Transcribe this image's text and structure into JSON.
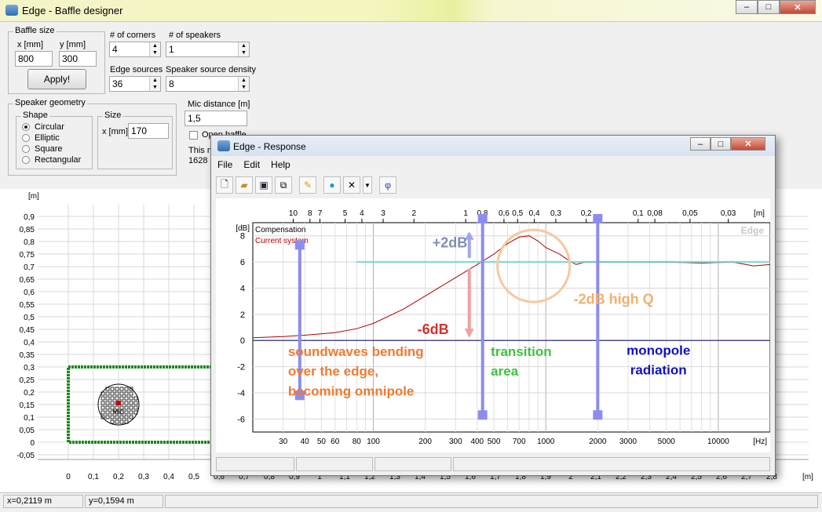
{
  "main_window": {
    "title": "Edge - Baffle designer",
    "caption_buttons": [
      "minimize",
      "maximize",
      "close"
    ]
  },
  "baffle_size": {
    "group_label": "Baffle size",
    "x_label": "x [mm]",
    "y_label": "y [mm]",
    "x_value": "800",
    "y_value": "300",
    "apply_label": "Apply!"
  },
  "corners": {
    "label": "# of corners",
    "value": "4"
  },
  "speakers": {
    "label": "# of speakers",
    "value": "1"
  },
  "edge_sources": {
    "label": "Edge sources",
    "value": "36"
  },
  "speaker_density": {
    "label": "Speaker source density",
    "value": "8"
  },
  "mic_distance": {
    "label": "Mic distance [m]",
    "value": "1,5"
  },
  "open_baffle": {
    "label": "Open baffle",
    "checked": false
  },
  "partial_info": {
    "line1": "This m",
    "line2": "1628"
  },
  "speaker_geometry": {
    "group_label": "Speaker geometry",
    "shape_label": "Shape",
    "shapes": [
      "Circular",
      "Elliptic",
      "Square",
      "Rectangular"
    ],
    "selected": "Circular",
    "size_label": "Size",
    "size_x_label": "x [mm]",
    "size_value": "170"
  },
  "baffle_plot": {
    "y_unit": "[m]",
    "x_unit": "[m]",
    "y_ticks": [
      "0,9",
      "0,85",
      "0,8",
      "0,75",
      "0,7",
      "0,65",
      "0,6",
      "0,55",
      "0,5",
      "0,45",
      "0,4",
      "0,35",
      "0,3",
      "0,25",
      "0,2",
      "0,15",
      "0,1",
      "0,05",
      "0",
      "-0,05"
    ],
    "x_ticks": [
      "0",
      "0,1",
      "0,2",
      "0,3",
      "0,4",
      "0,5",
      "0,6",
      "0,7",
      "0,8",
      "0,9",
      "1",
      "1,1",
      "1,2",
      "1,3",
      "1,4",
      "1,5",
      "1,6",
      "1,7",
      "1,8",
      "1,9",
      "2",
      "2,1",
      "2,2",
      "2,3",
      "2,4",
      "2,5",
      "2,6",
      "2,7",
      "2,8"
    ],
    "mic_label": "MIC"
  },
  "status_bar": {
    "x_readout": "x=0,2119 m",
    "y_readout": "y=0,1594 m"
  },
  "response_window": {
    "title": "Edge - Response",
    "menus": [
      "File",
      "Edit",
      "Help"
    ],
    "toolbar_icons": [
      "new-file-icon",
      "open-folder-icon",
      "save-icon",
      "copy-icon",
      "pencil-icon",
      "globe-icon",
      "delete-x-icon",
      "dropdown-arrow-icon",
      "phi-icon"
    ],
    "phi_glyph": "φ",
    "watermark": "Edge",
    "legend": [
      "Compensation",
      "Current system"
    ]
  },
  "chart_data": {
    "type": "line",
    "x_scale": "log",
    "xlabel": "[Hz]",
    "ylabel": "[dB]",
    "top_axis_label": "[m]",
    "xlim": [
      20,
      20000
    ],
    "ylim": [
      -7,
      9
    ],
    "x_ticks": [
      30,
      40,
      50,
      60,
      80,
      100,
      200,
      300,
      400,
      500,
      700,
      1000,
      2000,
      3000,
      5000,
      10000
    ],
    "y_ticks": [
      8,
      6,
      4,
      2,
      0,
      -2,
      -4,
      -6
    ],
    "top_ticks": [
      {
        "label": "10",
        "hz": 34.3
      },
      {
        "label": "8",
        "hz": 42.9
      },
      {
        "label": "7",
        "hz": 49
      },
      {
        "label": "5",
        "hz": 68.6
      },
      {
        "label": "4",
        "hz": 85.8
      },
      {
        "label": "3",
        "hz": 114
      },
      {
        "label": "2",
        "hz": 172
      },
      {
        "label": "1",
        "hz": 343
      },
      {
        "label": "0,8",
        "hz": 429
      },
      {
        "label": "0,6",
        "hz": 572
      },
      {
        "label": "0,5",
        "hz": 686
      },
      {
        "label": "0,4",
        "hz": 858
      },
      {
        "label": "0,3",
        "hz": 1143
      },
      {
        "label": "0,2",
        "hz": 1715
      },
      {
        "label": "0,1",
        "hz": 3430
      },
      {
        "label": "0,08",
        "hz": 4288
      },
      {
        "label": "0,05",
        "hz": 6860
      },
      {
        "label": "0,03",
        "hz": 11433
      }
    ],
    "series": [
      {
        "name": "Current system",
        "color": "#b00000",
        "x": [
          20,
          30,
          40,
          60,
          80,
          100,
          150,
          200,
          300,
          400,
          500,
          600,
          700,
          800,
          900,
          1000,
          1200,
          1400,
          1500,
          1700,
          2000,
          3000,
          5000,
          8000,
          12000,
          16000,
          20000
        ],
        "y": [
          0.2,
          0.3,
          0.4,
          0.6,
          0.9,
          1.3,
          2.4,
          3.4,
          4.8,
          5.8,
          6.6,
          7.4,
          7.9,
          8.0,
          7.6,
          7.1,
          6.6,
          6.0,
          5.8,
          6.0,
          6.0,
          6.0,
          6.0,
          5.9,
          6.0,
          5.7,
          5.8
        ]
      },
      {
        "name": "Compensation",
        "color": "#6fd6d6",
        "x": [
          80,
          20000
        ],
        "y": [
          6,
          6
        ]
      }
    ],
    "annotations": [
      {
        "text": "+2dB",
        "color": "#7f8fb5"
      },
      {
        "text": "-6dB",
        "color": "#d63030"
      },
      {
        "text": "-2dB high Q",
        "color": "#f0b070"
      },
      {
        "text": "soundwaves bending over the edge, becoming omnipole",
        "color": "#f07a30"
      },
      {
        "text": "transition area",
        "color": "#40c040"
      },
      {
        "text": "monopole radiation",
        "color": "#1010c0"
      }
    ]
  }
}
